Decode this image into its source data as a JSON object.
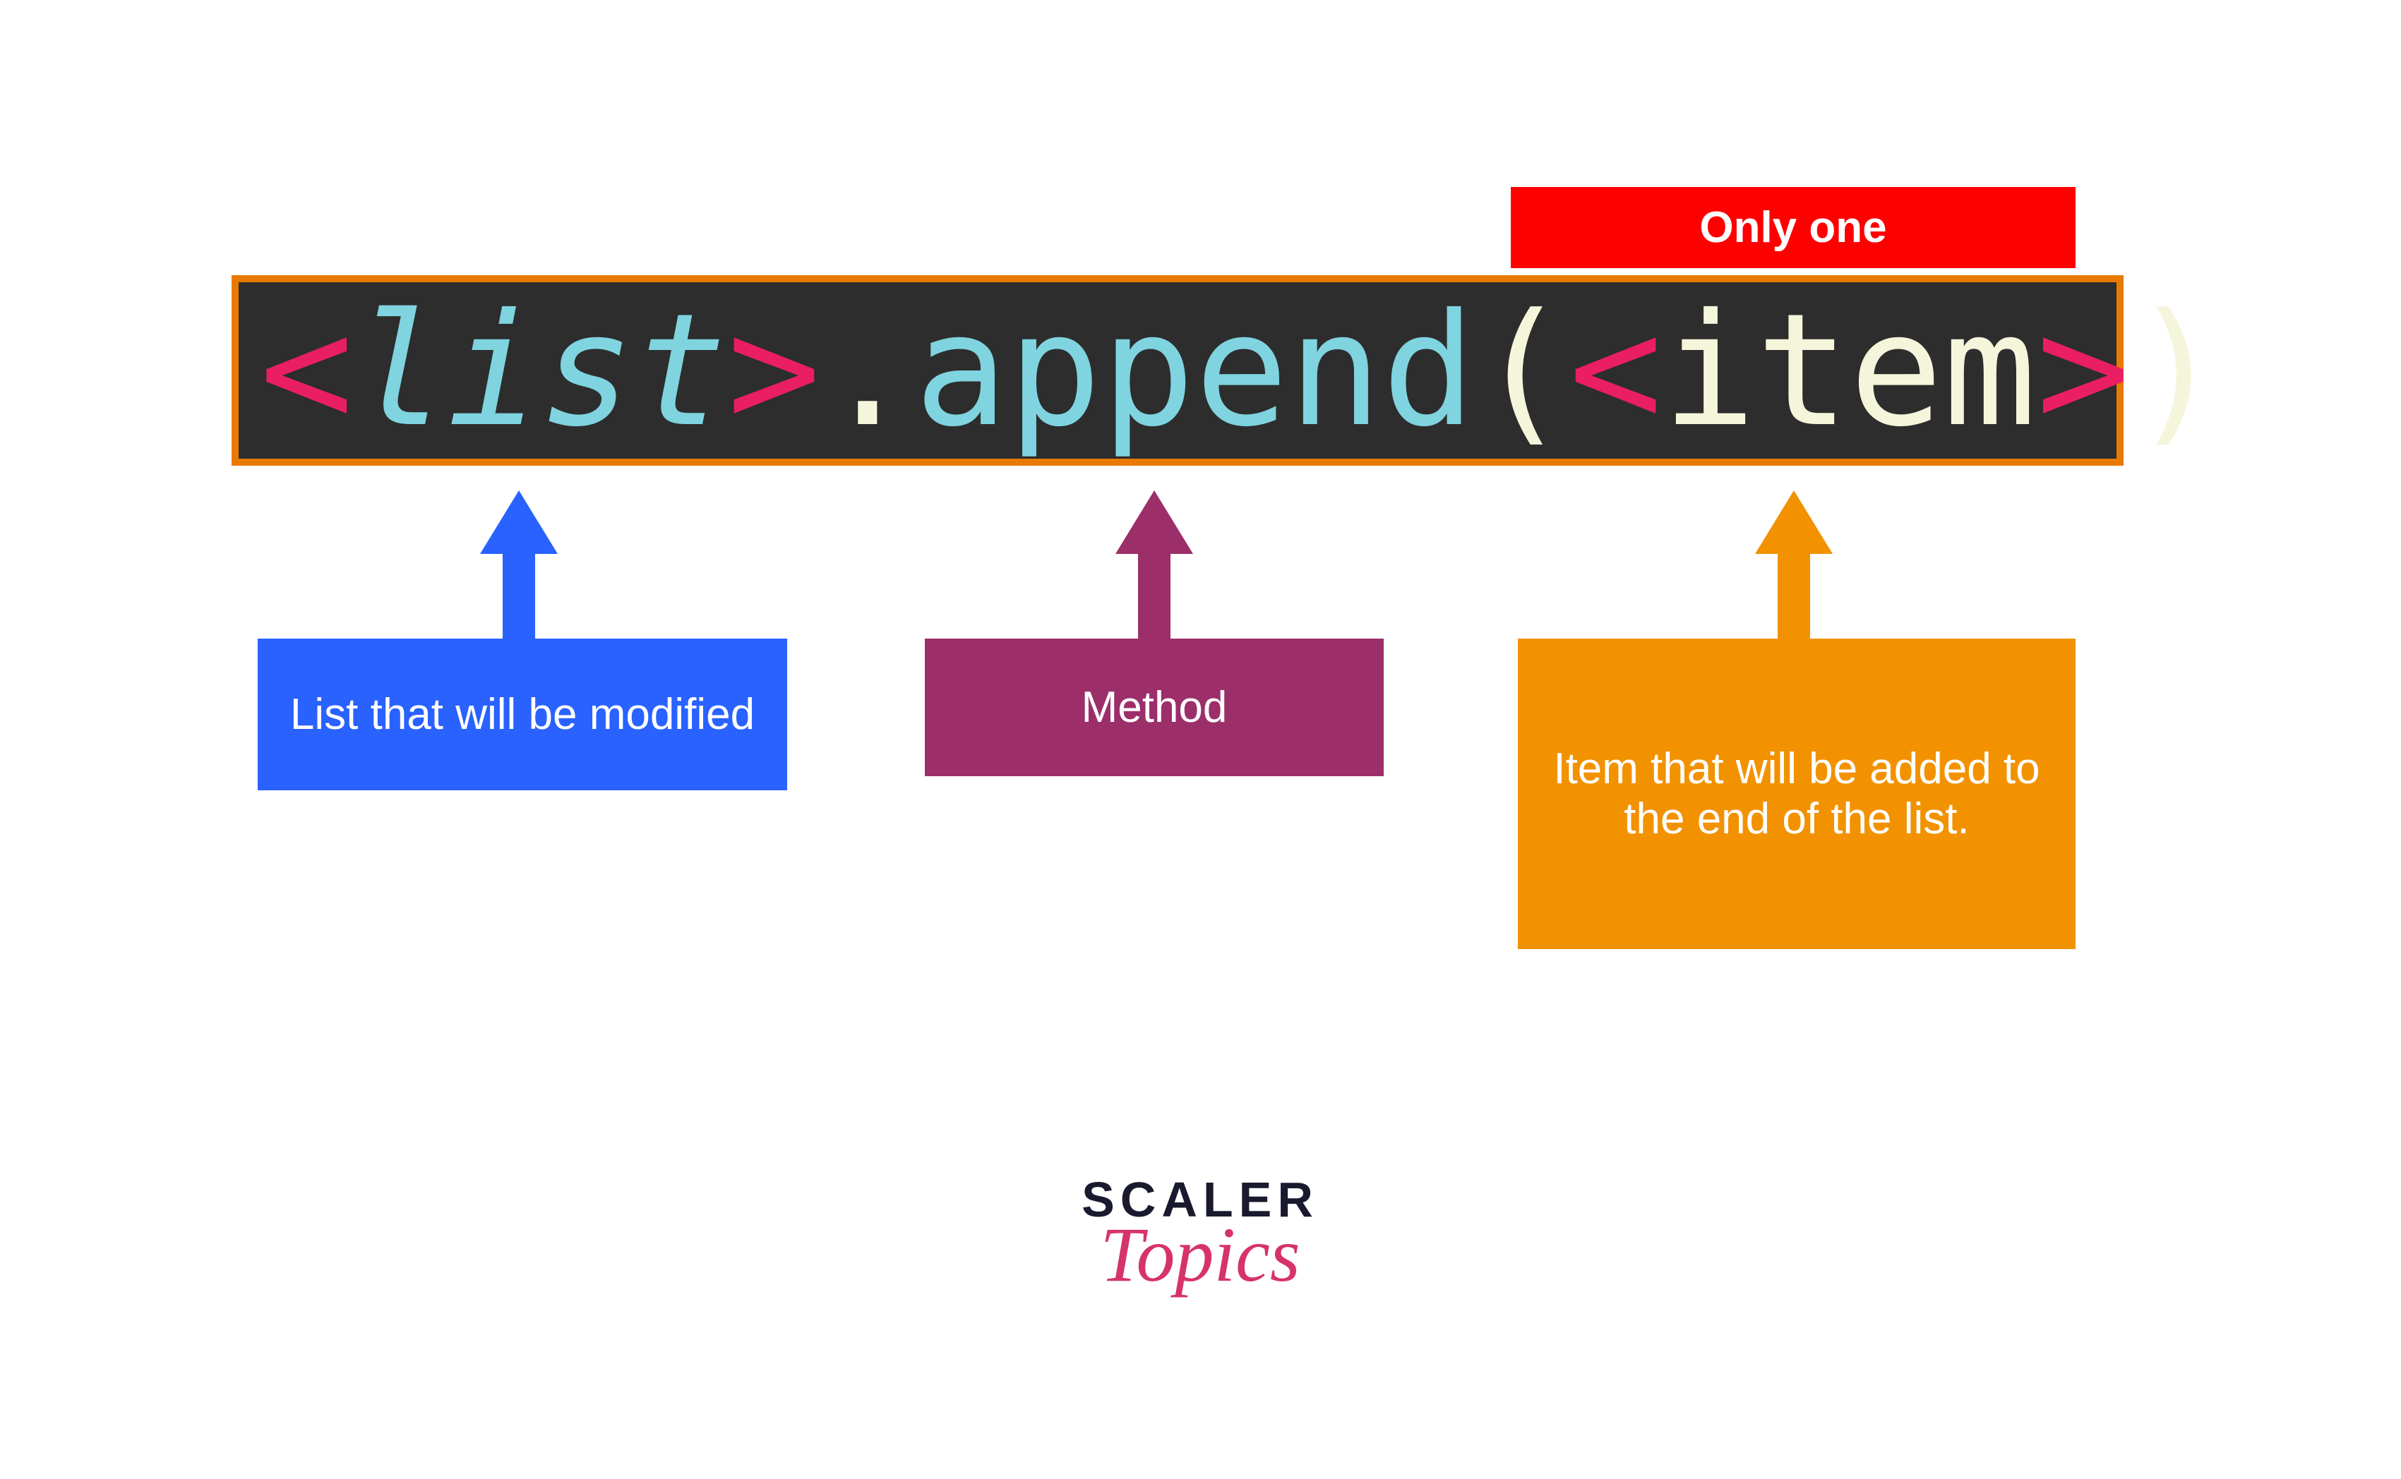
{
  "badge": {
    "only_one": "Only one"
  },
  "code": {
    "angle_open1": "<",
    "list": "list",
    "angle_close1": ">",
    "dot": ".",
    "append": "append",
    "paren_open": "(",
    "angle_open2": "<",
    "item": "item",
    "angle_close2": ">",
    "paren_close": ")"
  },
  "callouts": {
    "list_desc": "List that will be modified",
    "method_desc": "Method",
    "item_desc": "Item that will be added to the end of the list."
  },
  "logo": {
    "line1": "SCALER",
    "line2": "Topics"
  }
}
